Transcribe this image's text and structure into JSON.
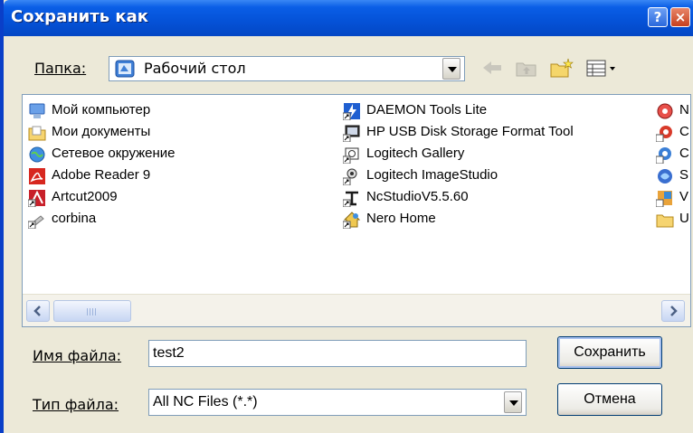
{
  "window": {
    "title": "Сохранить как",
    "help_glyph": "?",
    "close_glyph": "×"
  },
  "folder": {
    "label": "Папка:",
    "value": "Рабочий стол",
    "icon": "desktop-icon"
  },
  "toolbar": {
    "icons": [
      "back-icon",
      "up-folder-icon",
      "new-folder-icon",
      "view-menu-icon"
    ]
  },
  "files": {
    "col1": [
      {
        "label": "Мой компьютер",
        "icon": "my-computer-icon"
      },
      {
        "label": "Мои документы",
        "icon": "my-documents-icon"
      },
      {
        "label": "Сетевое окружение",
        "icon": "network-icon"
      },
      {
        "label": "Adobe Reader 9",
        "icon": "adobe-reader-icon"
      },
      {
        "label": "Artcut2009",
        "icon": "artcut-icon"
      },
      {
        "label": "corbina",
        "icon": "connection-icon"
      }
    ],
    "col2": [
      {
        "label": "DAEMON Tools Lite",
        "icon": "daemon-tools-icon"
      },
      {
        "label": "HP USB Disk Storage Format Tool",
        "icon": "hp-usb-icon"
      },
      {
        "label": "Logitech Gallery",
        "icon": "logitech-gallery-icon"
      },
      {
        "label": "Logitech ImageStudio",
        "icon": "logitech-imagestudio-icon"
      },
      {
        "label": "NcStudioV5.5.60",
        "icon": "ncstudio-icon"
      },
      {
        "label": "Nero Home",
        "icon": "nero-home-icon"
      }
    ],
    "col3": [
      {
        "label": "N",
        "icon": "app-icon"
      },
      {
        "label": "C",
        "icon": "app-icon"
      },
      {
        "label": "C",
        "icon": "app-icon"
      },
      {
        "label": "S",
        "icon": "app-icon"
      },
      {
        "label": "V",
        "icon": "app-icon"
      },
      {
        "label": "U",
        "icon": "folder-icon"
      }
    ]
  },
  "filename": {
    "label": "Имя файла:",
    "value": "test2"
  },
  "filetype": {
    "label": "Тип файла:",
    "value": "All NC Files (*.*)"
  },
  "buttons": {
    "save": "Сохранить",
    "cancel": "Отмена"
  },
  "colors": {
    "titlebar": "#0553d9",
    "face": "#ece9d8",
    "border": "#7f9db9"
  }
}
